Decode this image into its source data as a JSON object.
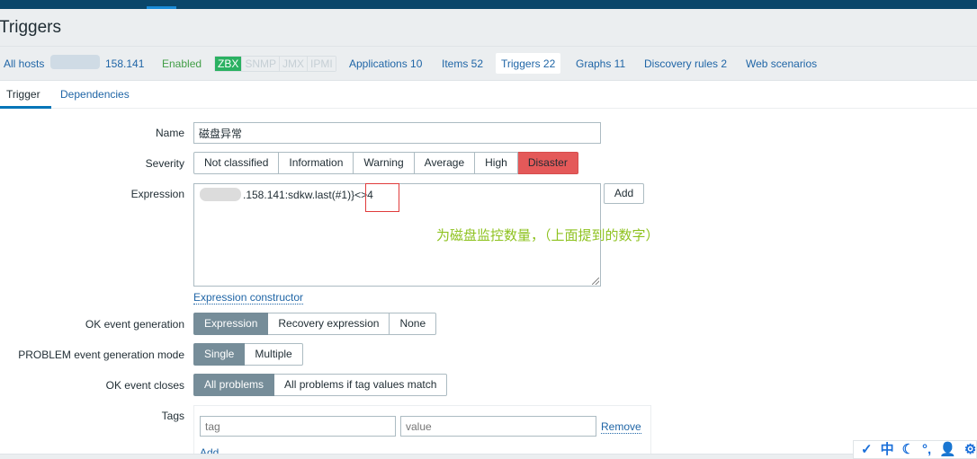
{
  "page": {
    "title": "Triggers"
  },
  "host_nav": {
    "all_hosts": "All hosts",
    "host_separator": "/",
    "host_name_suffix": "158.141",
    "status": "Enabled",
    "availability": [
      "ZBX",
      "SNMP",
      "JMX",
      "IPMI"
    ],
    "links": [
      {
        "label": "Applications 10"
      },
      {
        "label": "Items 52"
      },
      {
        "label": "Triggers 22"
      },
      {
        "label": "Graphs 11"
      },
      {
        "label": "Discovery rules 2"
      },
      {
        "label": "Web scenarios"
      }
    ]
  },
  "form_tabs": {
    "trigger": "Trigger",
    "dependencies": "Dependencies"
  },
  "form": {
    "name_label": "Name",
    "name_value": "磁盘异常",
    "severity_label": "Severity",
    "severity_options": [
      "Not classified",
      "Information",
      "Warning",
      "Average",
      "High",
      "Disaster"
    ],
    "severity_selected": "Disaster",
    "expression_label": "Expression",
    "expression_value": ".158.141:sdkw.last(#1)}<>4",
    "add_button": "Add",
    "expression_constructor": "Expression constructor",
    "ok_event_generation_label": "OK event generation",
    "ok_event_generation_options": [
      "Expression",
      "Recovery expression",
      "None"
    ],
    "ok_event_generation_selected": "Expression",
    "problem_mode_label": "PROBLEM event generation mode",
    "problem_mode_options": [
      "Single",
      "Multiple"
    ],
    "problem_mode_selected": "Single",
    "ok_closes_label": "OK event closes",
    "ok_closes_options": [
      "All problems",
      "All problems if tag values match"
    ],
    "ok_closes_selected": "All problems",
    "tags_label": "Tags",
    "tag_placeholder": "tag",
    "value_placeholder": "value",
    "remove_link": "Remove",
    "add_link": "Add"
  },
  "annotation": {
    "text": "为磁盘监控数量，（上面提到的数字）",
    "color": "#8ec21f",
    "box_color": "#e03c3c"
  },
  "ime_toolbar": {
    "items": [
      "✓",
      "中",
      "☾",
      "°,",
      "👤",
      "⚙"
    ]
  },
  "colors": {
    "header": "#0a466a",
    "link": "#1f65a6",
    "disaster": "#e45959",
    "selected": "#768d99",
    "enabled": "#429e47",
    "zbx": "#2bb162"
  }
}
